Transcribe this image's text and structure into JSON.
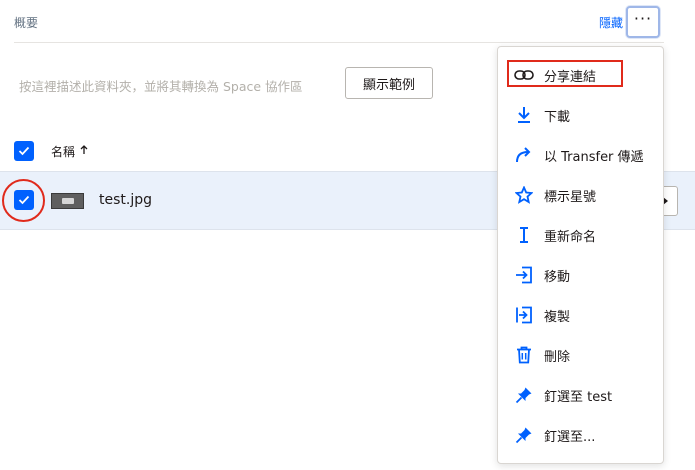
{
  "header": {
    "overview_label": "概要",
    "hide_label": "隱藏",
    "more_label": "···"
  },
  "description": {
    "text": "按這裡描述此資料夾，並將其轉換為 Space 協作區",
    "show_example_label": "顯示範例"
  },
  "file_list": {
    "column_name": "名稱",
    "files": [
      {
        "name": "test.jpg",
        "selected": true
      }
    ]
  },
  "context_menu": {
    "items": [
      {
        "label": "分享連結",
        "icon": "link-icon"
      },
      {
        "label": "下載",
        "icon": "download-icon"
      },
      {
        "label": "以 Transfer 傳遞",
        "icon": "transfer-arrow-icon"
      },
      {
        "label": "標示星號",
        "icon": "star-icon"
      },
      {
        "label": "重新命名",
        "icon": "rename-cursor-icon"
      },
      {
        "label": "移動",
        "icon": "move-icon"
      },
      {
        "label": "複製",
        "icon": "copy-icon"
      },
      {
        "label": "刪除",
        "icon": "trash-icon"
      },
      {
        "label": "釘選至 test",
        "icon": "pin-icon"
      },
      {
        "label": "釘選至...",
        "icon": "pin-icon"
      }
    ]
  },
  "colors": {
    "accent": "#0061fe",
    "highlight_red": "#e02a1b",
    "selected_row": "#eaf1fb"
  }
}
